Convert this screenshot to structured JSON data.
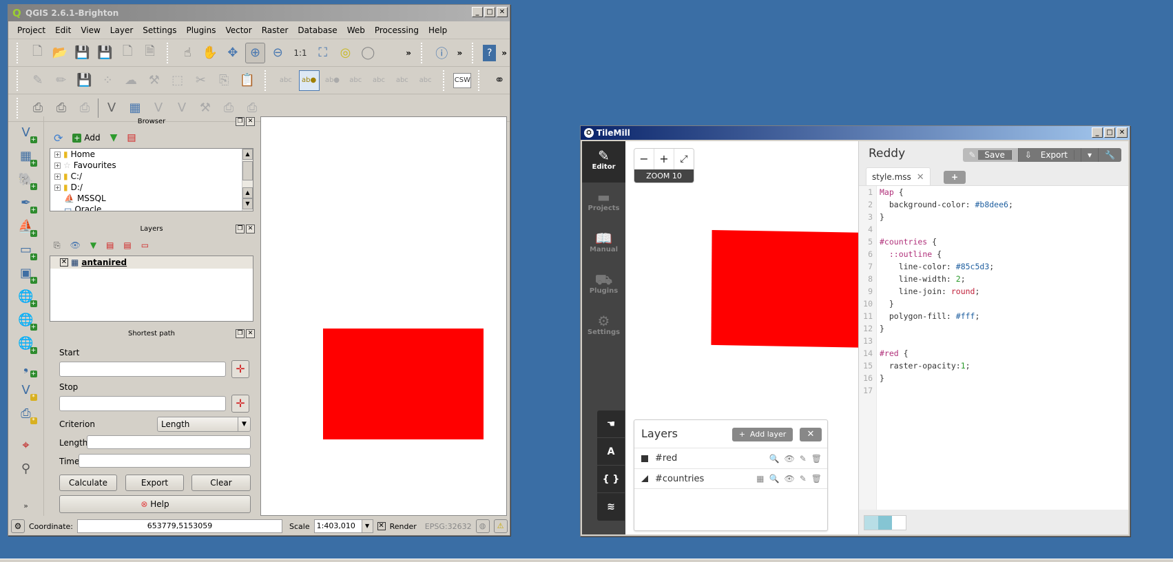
{
  "qgis": {
    "title": "QGIS 2.6.1-Brighton",
    "window_controls": [
      "_",
      "□",
      "✕"
    ],
    "menu": [
      "Project",
      "Edit",
      "View",
      "Layer",
      "Settings",
      "Plugins",
      "Vector",
      "Raster",
      "Database",
      "Web",
      "Processing",
      "Help"
    ],
    "browser": {
      "title": "Browser",
      "add_label": "Add",
      "items": [
        "Home",
        "Favourites",
        "C:/",
        "D:/",
        "MSSQL",
        "Oracle"
      ]
    },
    "layers": {
      "title": "Layers",
      "items": [
        {
          "name": "antanired",
          "checked": true
        }
      ]
    },
    "shortest_path": {
      "title": "Shortest path",
      "start_label": "Start",
      "start_value": "",
      "stop_label": "Stop",
      "stop_value": "",
      "criterion_label": "Criterion",
      "criterion_value": "Length",
      "length_label": "Length",
      "length_value": "",
      "time_label": "Time",
      "time_value": "",
      "calculate_label": "Calculate",
      "export_label": "Export",
      "clear_label": "Clear",
      "help_label": "Help"
    },
    "map": {
      "raster_color": "#ff0000"
    },
    "status": {
      "coordinate_label": "Coordinate:",
      "coordinate_value": "653779,5153059",
      "scale_label": "Scale",
      "scale_value": "1:403,010",
      "render_label": "Render",
      "render_checked": true,
      "crs": "EPSG:32632"
    }
  },
  "tilemill": {
    "title": "TileMill",
    "window_controls": [
      "_",
      "□",
      "✕"
    ],
    "nav": [
      {
        "label": "Editor",
        "icon": "pencil-icon",
        "active": true
      },
      {
        "label": "Projects",
        "icon": "folder-icon",
        "active": false
      },
      {
        "label": "Manual",
        "icon": "book-icon",
        "active": false
      },
      {
        "label": "Plugins",
        "icon": "plugin-icon",
        "active": false
      },
      {
        "label": "Settings",
        "icon": "gear-icon",
        "active": false
      }
    ],
    "zoom": {
      "minus": "−",
      "plus": "+",
      "fullscreen": "⤢",
      "level_label": "ZOOM 10"
    },
    "tools": [
      "☚",
      "A",
      "{ }",
      "≋"
    ],
    "layers_panel": {
      "title": "Layers",
      "add_label": "Add layer",
      "close": "✕",
      "items": [
        {
          "name": "#red",
          "type": "raster"
        },
        {
          "name": "#countries",
          "type": "polygon"
        }
      ]
    },
    "project_name": "Reddy",
    "actions": {
      "save": "Save",
      "export": "Export"
    },
    "tab": {
      "name": "style.mss",
      "close": "✕",
      "new": "+"
    },
    "code_lines": [
      "Map {",
      "  background-color: #b8dee6;",
      "}",
      "",
      "#countries {",
      "  ::outline {",
      "    line-color: #85c5d3;",
      "    line-width: 2;",
      "    line-join: round;",
      "  }",
      "  polygon-fill: #fff;",
      "}",
      "",
      "#red {",
      "  raster-opacity:1;",
      "}",
      ""
    ],
    "palette": [
      "#b8dee6",
      "#85c5d3",
      "#ffffff"
    ]
  }
}
